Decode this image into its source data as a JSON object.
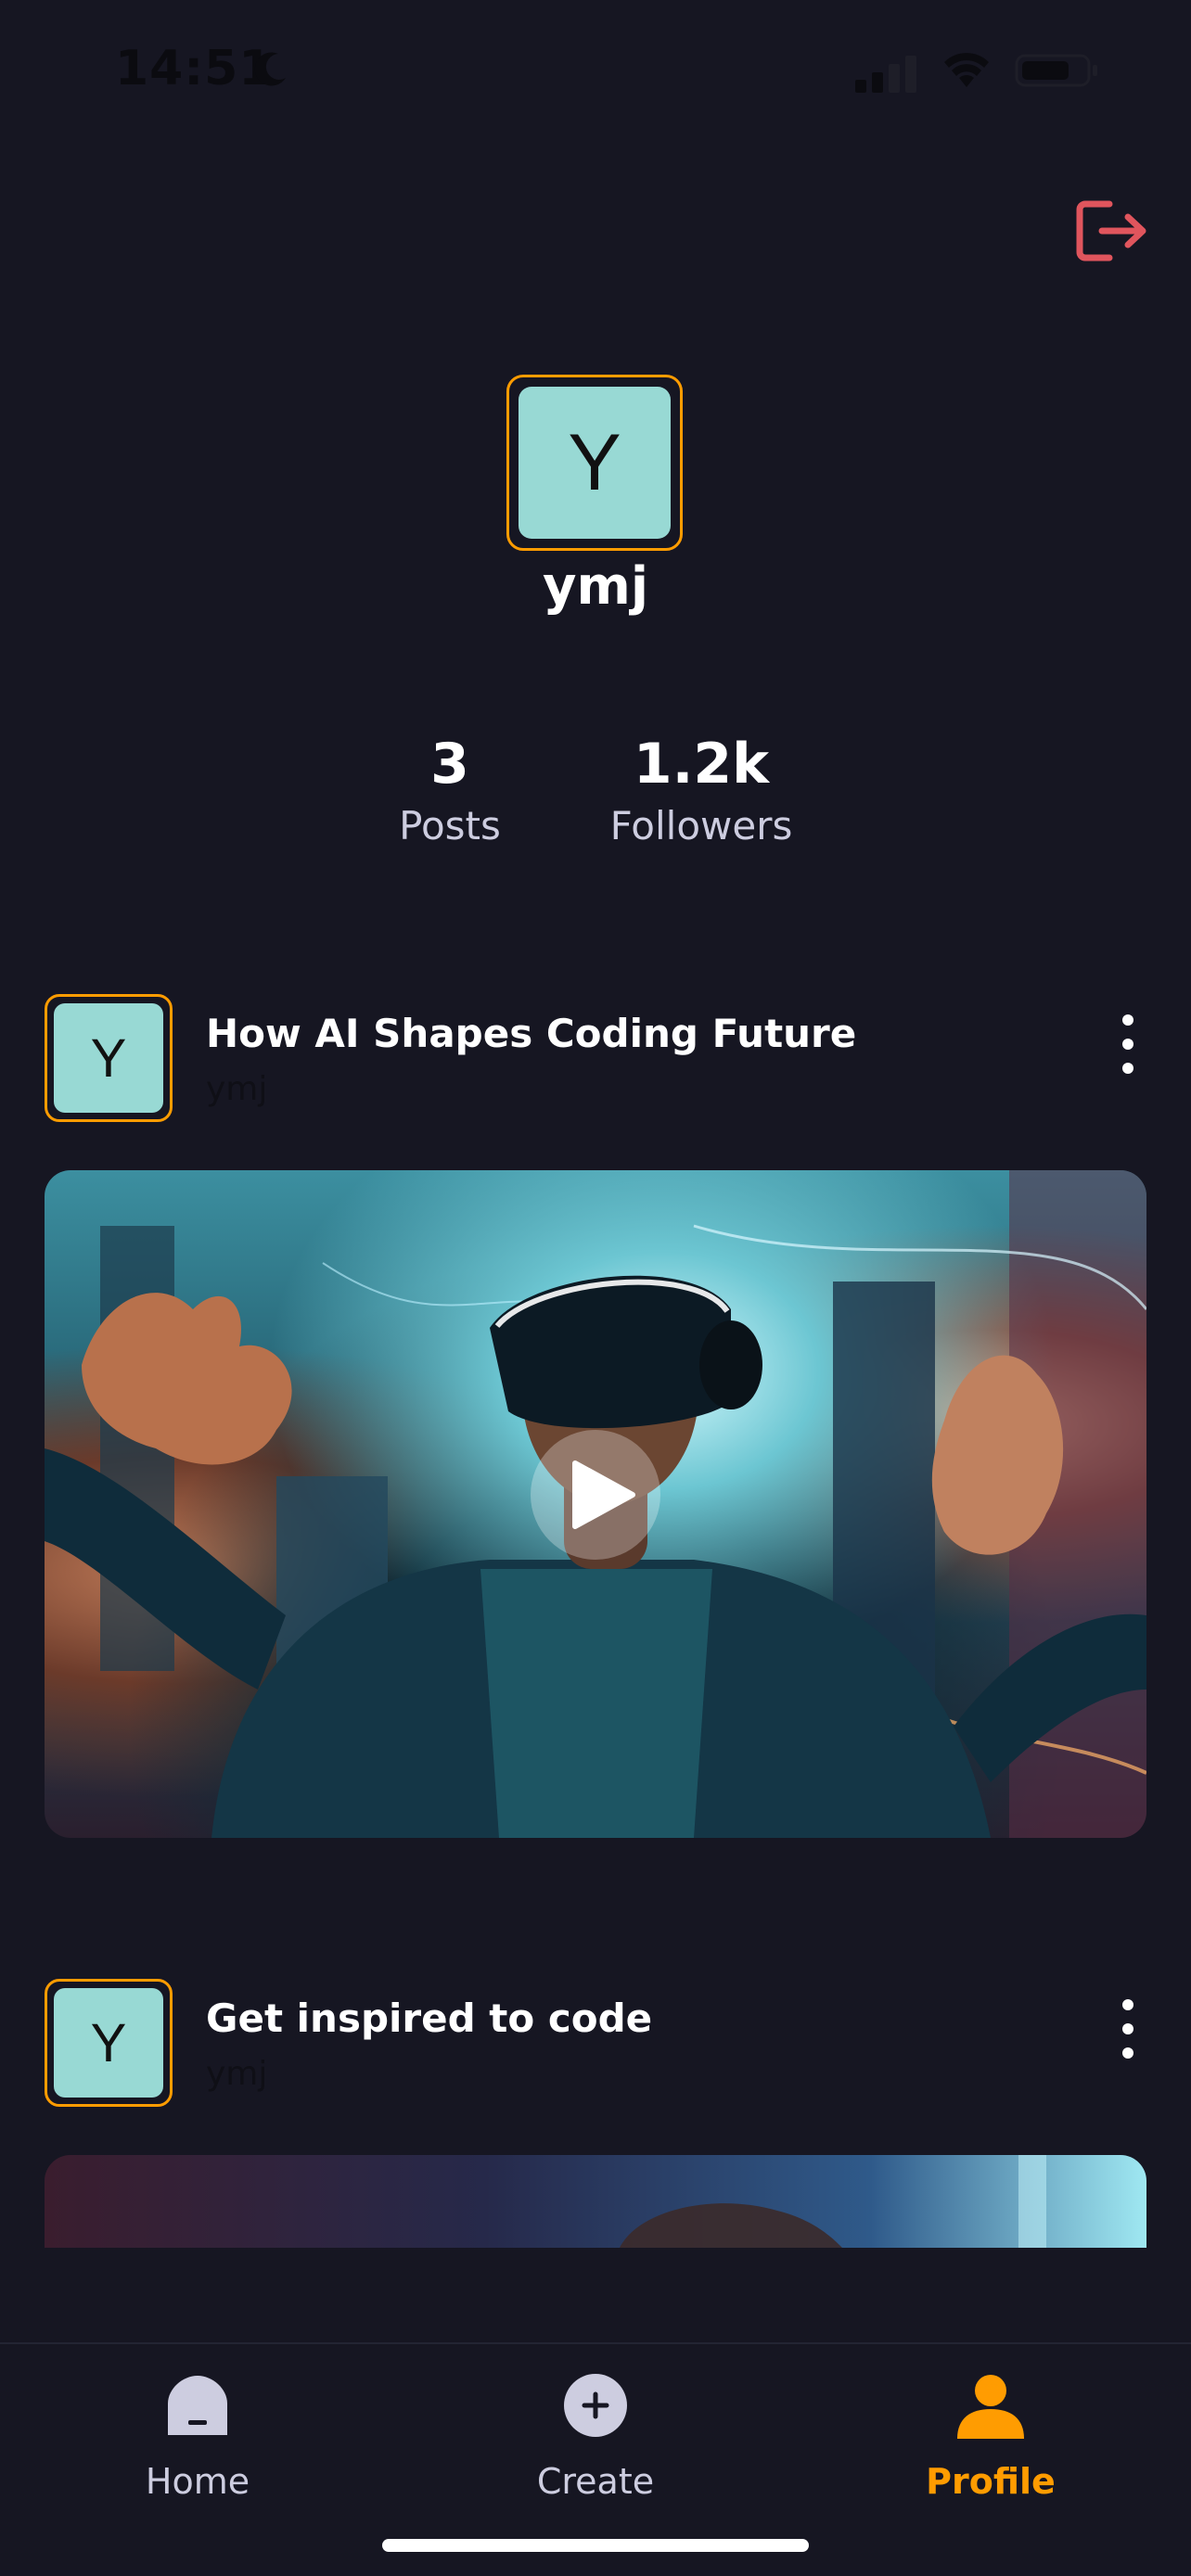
{
  "status_bar": {
    "time": "14:51",
    "icons": [
      "moon-icon",
      "signal-icon",
      "wifi-icon",
      "battery-icon"
    ]
  },
  "header": {
    "logout_icon": "logout-icon"
  },
  "profile": {
    "avatar_letter": "Y",
    "username": "ymj",
    "stats": {
      "posts_value": "3",
      "posts_label": "Posts",
      "followers_value": "1.2k",
      "followers_label": "Followers"
    }
  },
  "posts": [
    {
      "avatar_letter": "Y",
      "title": "How AI Shapes Coding Future",
      "author": "ymj",
      "menu_icon": "more-vertical-icon",
      "thumbnail": "vr-headset-person-city-image",
      "play_icon": "play-icon"
    },
    {
      "avatar_letter": "Y",
      "title": "Get inspired to code",
      "author": "ymj",
      "menu_icon": "more-vertical-icon",
      "thumbnail": "coding-inspiration-image"
    }
  ],
  "tab_bar": {
    "tabs": [
      {
        "label": "Home",
        "icon": "home-icon",
        "active": false
      },
      {
        "label": "Create",
        "icon": "plus-icon",
        "active": false
      },
      {
        "label": "Profile",
        "icon": "profile-icon",
        "active": true
      }
    ]
  },
  "colors": {
    "background": "#161622",
    "accent": "#ff9c01",
    "logout": "#e0555d",
    "avatar_fill": "#98d9d4",
    "muted_text": "#cdcde0"
  }
}
